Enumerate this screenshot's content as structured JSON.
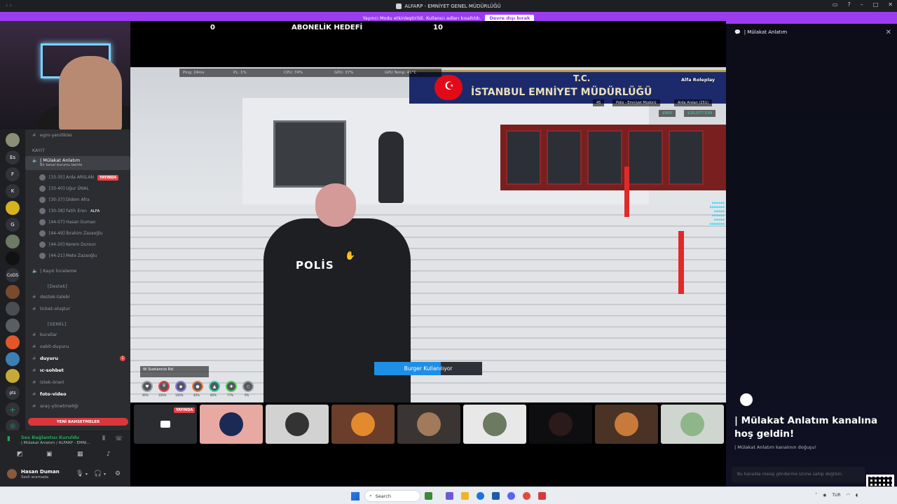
{
  "window": {
    "title": "ALFARP - EMNİYET GENEL MÜDÜRLÜĞÜ",
    "streamer_notice": "Yayıncı Modu etkinleştirildi. Kullanıcı adları kısaltıldı.",
    "streamer_off": "Devre dışı bırak"
  },
  "rail": {
    "servers": [
      "Es",
      "F",
      "K",
      "G",
      "CoDS",
      "pts"
    ]
  },
  "channels": {
    "items": [
      {
        "label": "egm-yenilikler"
      },
      {
        "label": "| Mülakat Anlatım",
        "sub": "Bir kanal durumu belirle"
      },
      {
        "label": "| Kayıt İnceleme"
      },
      {
        "label": "destek-talebi"
      },
      {
        "label": "ticket-oluştur"
      },
      {
        "label": "kurallar"
      },
      {
        "label": "sabit-duyuru"
      },
      {
        "label": "duyuru",
        "badge": "1"
      },
      {
        "label": "ıc-sohbet"
      },
      {
        "label": "istek-öneri"
      },
      {
        "label": "foto-video"
      },
      {
        "label": "araç-yönetmeliği"
      }
    ],
    "categories": [
      "KAYIT",
      "[Destek]",
      "[GENEL]"
    ],
    "voice_users": [
      {
        "name": "[33-35] Arda ARSLAN",
        "live": "YAYINDA"
      },
      {
        "name": "[33-40] Uğur ÜNAL"
      },
      {
        "name": "[30-37] Didem Afra"
      },
      {
        "name": "[30-38] Fatih Eren",
        "tag": "ALFA"
      },
      {
        "name": "[44-07] Hasan Duman"
      },
      {
        "name": "[44-49] İbrahim Zazaoğlu"
      },
      {
        "name": "[44-20] Kerem Dursun"
      },
      {
        "name": "[44-21] Mete Zazaoğlu"
      }
    ],
    "new_messages": "YENİ BAHSETMELER"
  },
  "voice": {
    "status": "Ses Bağlantısı Kuruldu",
    "channel": "| Mülakat Anlatım / ALFARP - EMNİ..."
  },
  "user": {
    "name": "Hasan Duman",
    "status": "Sesli aramada"
  },
  "game": {
    "goal_left": "0",
    "goal_title": "ABONELİK HEDEFİ",
    "goal_right": "10",
    "perf": [
      "Ping: 24ms",
      "PL: 1%",
      "CPU: 74%",
      "GPU: 37%",
      "GPU Temp: 41°C"
    ],
    "banner_tc": "T.C.",
    "banner_name": "İSTANBUL EMNİYET MÜDÜRLÜĞÜ",
    "logo": "Alfa Roleplay",
    "hud_job": "Polis - Emniyet Müdürü",
    "hud_name": "Arda Arslan (251)",
    "hud_id": "45",
    "money_cash": "$800",
    "money_bank": "$10,077,539",
    "vest_text": "POLİS",
    "progress_label": "Burger Kullanılıyor",
    "progress_value": 0.62,
    "street": "Sustancio Rd",
    "stats": [
      "46%",
      "100%",
      "100%",
      "40%",
      "80%",
      "77%",
      "0%"
    ]
  },
  "strip": {
    "live_label": "YAYINDA",
    "tiles": 9
  },
  "rpanel": {
    "header": "| Mülakat Anlatım",
    "welcome": "| Mülakat Anlatım kanalına hoş geldin!",
    "start": "| Mülakat Anlatım kanalının doğuşu!",
    "composer": "Bu kanalda mesaj gönderme iznine sahip değilsin."
  },
  "taskbar": {
    "search": "Search",
    "lang": "TUR"
  },
  "colors": {
    "streamer_purple": "#9b3cf0",
    "live_red": "#ed4245",
    "progress_blue": "#1e8fe6",
    "connected_green": "#23a559"
  }
}
